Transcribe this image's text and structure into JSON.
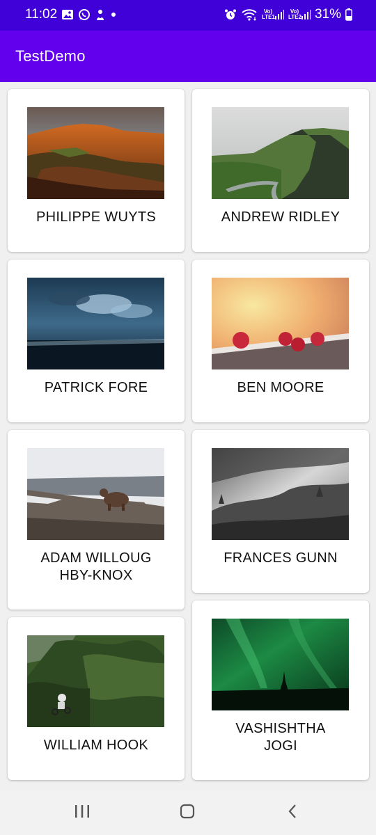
{
  "status_bar": {
    "time": "11:02",
    "left_icons": [
      "gallery-icon",
      "whatsapp-icon",
      "app-icon",
      "dot-icon"
    ],
    "right_icons": [
      "alarm-icon",
      "wifi-icon",
      "signal-lte1-icon",
      "signal-lte2-icon",
      "battery-icon"
    ],
    "lte1_label_top": "Vo)",
    "lte1_label_bottom": "LTE1",
    "lte2_label_top": "Vo)",
    "lte2_label_bottom": "LTE2",
    "battery": "31%"
  },
  "app_bar": {
    "title": "TestDemo",
    "color": "#6200ee",
    "status_color": "#3f01d8"
  },
  "cards": [
    {
      "name": "PHILIPPE WUYTS",
      "image": "red-rock-canyon-photo"
    },
    {
      "name": "ANDREW RIDLEY",
      "image": "green-mountain-road-photo"
    },
    {
      "name": "PATRICK FORE",
      "image": "stormy-sea-photo"
    },
    {
      "name": "BEN MOORE",
      "image": "raspberries-photo"
    },
    {
      "name": "ADAM WILLOUG HBY-KNOX",
      "name_line1": "ADAM WILLOUG",
      "name_line2": "HBY-KNOX",
      "image": "bear-on-hill-photo"
    },
    {
      "name": "FRANCES GUNN",
      "image": "misty-forest-photo"
    },
    {
      "name": "WILLIAM HOOK",
      "image": "mountain-biker-forest-photo"
    },
    {
      "name": "VASHISHTHA JOGI",
      "name_line1": "VASHISHTHA",
      "name_line2": "JOGI",
      "image": "aurora-photo"
    }
  ],
  "nav_bar": {
    "buttons": [
      "recents-icon",
      "home-icon",
      "back-icon"
    ]
  }
}
